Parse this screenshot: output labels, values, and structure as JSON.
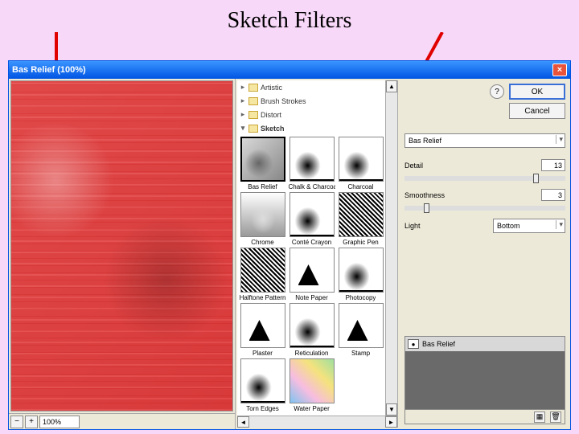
{
  "slide_title": "Sketch Filters",
  "titlebar": {
    "title": "Bas Relief (100%)"
  },
  "zoom": {
    "minus": "−",
    "plus": "+",
    "value": "100%"
  },
  "categories": [
    {
      "label": "Artistic",
      "open": false
    },
    {
      "label": "Brush Strokes",
      "open": false
    },
    {
      "label": "Distort",
      "open": false
    },
    {
      "label": "Sketch",
      "open": true
    }
  ],
  "thumbs": [
    {
      "label": "Bas Relief",
      "art": "relief",
      "selected": true
    },
    {
      "label": "Chalk & Charcoal",
      "art": "bw"
    },
    {
      "label": "Charcoal",
      "art": "bw"
    },
    {
      "label": "Chrome",
      "art": "chrome"
    },
    {
      "label": "Conté Crayon",
      "art": "bw"
    },
    {
      "label": "Graphic Pen",
      "art": "lines"
    },
    {
      "label": "Halftone Pattern",
      "art": "lines"
    },
    {
      "label": "Note Paper",
      "art": "note"
    },
    {
      "label": "Photocopy",
      "art": "bw"
    },
    {
      "label": "Plaster",
      "art": "note"
    },
    {
      "label": "Reticulation",
      "art": "bw"
    },
    {
      "label": "Stamp",
      "art": "note"
    },
    {
      "label": "Torn Edges",
      "art": "bw"
    },
    {
      "label": "Water Paper",
      "art": "color"
    }
  ],
  "buttons": {
    "ok": "OK",
    "cancel": "Cancel"
  },
  "filter_select": "Bas Relief",
  "params": {
    "detail": {
      "label": "Detail",
      "value": "13"
    },
    "smoothness": {
      "label": "Smoothness",
      "value": "3"
    },
    "light": {
      "label": "Light",
      "value": "Bottom"
    }
  },
  "layer": {
    "name": "Bas Relief"
  }
}
